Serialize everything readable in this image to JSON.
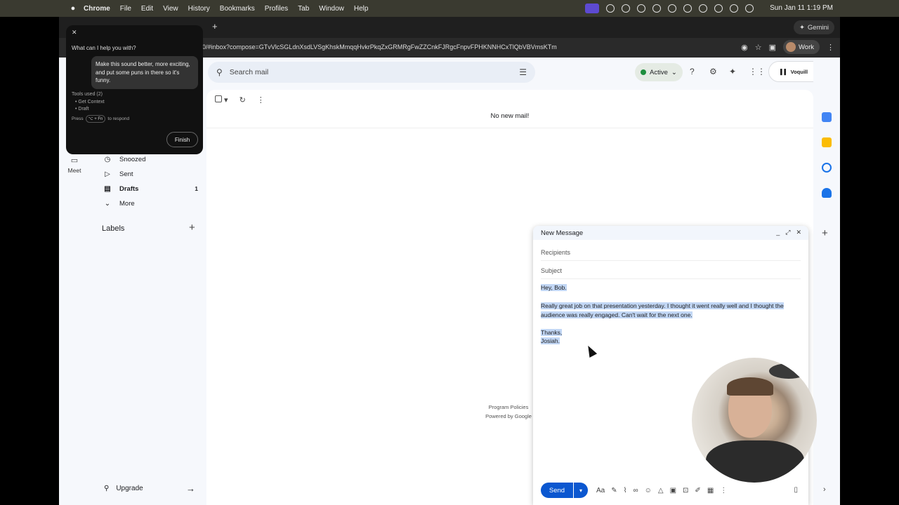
{
  "menubar": {
    "apple": "",
    "app": "Chrome",
    "items": [
      "File",
      "Edit",
      "View",
      "History",
      "Bookmarks",
      "Profiles",
      "Tab",
      "Window",
      "Help"
    ],
    "clock": "Sun Jan 11  1:19 PM"
  },
  "browser": {
    "gemini_button": "Gemini",
    "url": "0/#inbox?compose=GTvVlcSGLdnXsdLVSgKhskMmqqHvkrPkqZxGRMRgFwZZCnkFJRgcFnpvFPHKNNHCxTlQbVBVmsKTm",
    "profile_chip": "Work"
  },
  "gemini_popup": {
    "question": "What can I help you with?",
    "prompt": "Make this sound better, more exciting, and put some puns in there so it's funny.",
    "tools_used_label": "Tools used (2)",
    "tools": [
      "• Get Context",
      "• Draft"
    ],
    "press_prefix": "Press",
    "press_key": "⌥ + Fn",
    "press_suffix": "to respond",
    "finish_label": "Finish"
  },
  "rail": {
    "meet_label": "Meet"
  },
  "nav": {
    "snoozed": "Snoozed",
    "sent": "Sent",
    "drafts": "Drafts",
    "drafts_count": "1",
    "more": "More",
    "labels_heading": "Labels",
    "upgrade": "Upgrade"
  },
  "topbar": {
    "search_placeholder": "Search mail",
    "status": "Active",
    "account_brand": "Voquill"
  },
  "mail": {
    "empty_message": "No new mail!",
    "footer_program_policies": "Program Policies",
    "footer_powered": "Powered by Google"
  },
  "compose": {
    "title": "New Message",
    "recipients_placeholder": "Recipients",
    "subject_placeholder": "Subject",
    "body_greeting": "Hey, Bob.",
    "body_main": "Really great job on that presentation yesterday. I thought it went really well and I thought the audience was really engaged. Can't wait for the next one.",
    "body_thanks": "Thanks,",
    "body_name": "Josiah.",
    "send_label": "Send",
    "format_label": "Aa"
  },
  "colors": {
    "gmail_blue": "#0b57d0",
    "active_green": "#1e8e3e",
    "selection": "#c2d7f5"
  }
}
